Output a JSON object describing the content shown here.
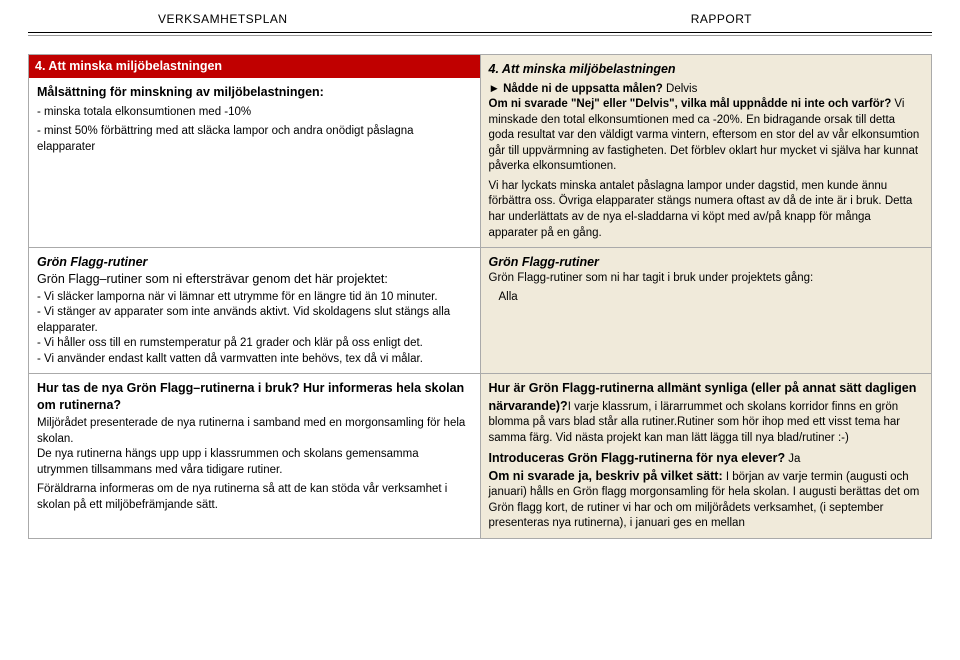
{
  "header": {
    "left": "VERKSAMHETSPLAN",
    "right": "RAPPORT"
  },
  "left": {
    "row1": {
      "title": "4. Att minska miljöbelastningen",
      "sub": "Målsättning för minskning av miljöbelastningen:",
      "b1": "- minska totala elkonsumtionen med -10%",
      "b2": "- minst 50% förbättring med att släcka lampor och andra onödigt påslagna elapparater"
    },
    "row2": {
      "title": "Grön Flagg-rutiner",
      "sub": "Grön Flagg–rutiner som ni eftersträvar genom det här projektet:",
      "b1": "- Vi släcker lamporna när vi lämnar ett utrymme för en längre tid än 10 minuter.",
      "b2": "- Vi stänger av apparater som inte används aktivt. Vid skoldagens slut stängs alla elapparater.",
      "b3": "- Vi håller oss till en rumstemperatur på 21 grader och klär på oss enligt det.",
      "b4": "- Vi använder endast kallt vatten då varmvatten inte behövs, tex då vi målar."
    },
    "row3": {
      "q": "Hur tas de nya Grön Flagg–rutinerna i bruk? Hur informeras hela skolan om rutinerna?",
      "p1": "Miljörådet presenterade de nya rutinerna i samband med en morgonsamling för hela skolan.",
      "p2": "De nya rutinerna hängs upp upp i klassrummen och skolans gemensamma utrymmen tillsammans med våra tidigare rutiner.",
      "p3": "Föräldrarna informeras om de nya rutinerna så att de kan stöda vår verksamhet i skolan på ett miljöbefrämjande sätt."
    }
  },
  "right": {
    "row1": {
      "title": "4. Att minska miljöbelastningen",
      "q1a": "► Nådde ni de uppsatta målen?",
      "q1b": " Delvis",
      "q2": "Om ni svarade \"Nej\" eller \"Delvis\", vilka mål uppnådde ni inte och varför?",
      "p1": " Vi minskade den total elkonsumtionen med ca -20%. En bidragande orsak till detta goda resultat var den väldigt varma vintern, eftersom en stor del av vår elkonsumtion går till uppvärmning av fastigheten. Det förblev oklart hur mycket vi själva har kunnat påverka elkonsumtionen.",
      "p2": "Vi har lyckats minska antalet påslagna lampor under dagstid, men kunde ännu förbättra oss. Övriga elapparater stängs numera oftast av då de inte är i bruk. Detta har underlättats av de nya el-sladdarna vi köpt med av/på knapp för många apparater på en gång."
    },
    "row2": {
      "title": "Grön Flagg-rutiner",
      "sub": "Grön Flagg-rutiner som ni har tagit i bruk under projektets gång:",
      "ans": "Alla"
    },
    "row3": {
      "q1": "Hur är Grön Flagg-rutinerna allmänt synliga (eller på annat sätt dagligen närvarande)?",
      "a1": "I varje klassrum, i lärarrummet och skolans korridor finns en grön blomma på vars blad står alla rutiner.Rutiner som hör ihop med ett visst tema har samma färg. Vid nästa projekt kan man lätt lägga till nya blad/rutiner :-)",
      "q2a": "Introduceras Grön Flagg-rutinerna för nya elever?",
      "q2b": " Ja",
      "q3": "Om ni svarade ja, beskriv på vilket sätt:",
      "a3": " I början av varje termin (augusti och januari) hålls en Grön flagg morgonsamling för hela skolan. I augusti berättas det om Grön flagg kort, de rutiner vi har och om miljörådets verksamhet, (i september presenteras nya rutinerna), i januari ges en mellan"
    }
  }
}
